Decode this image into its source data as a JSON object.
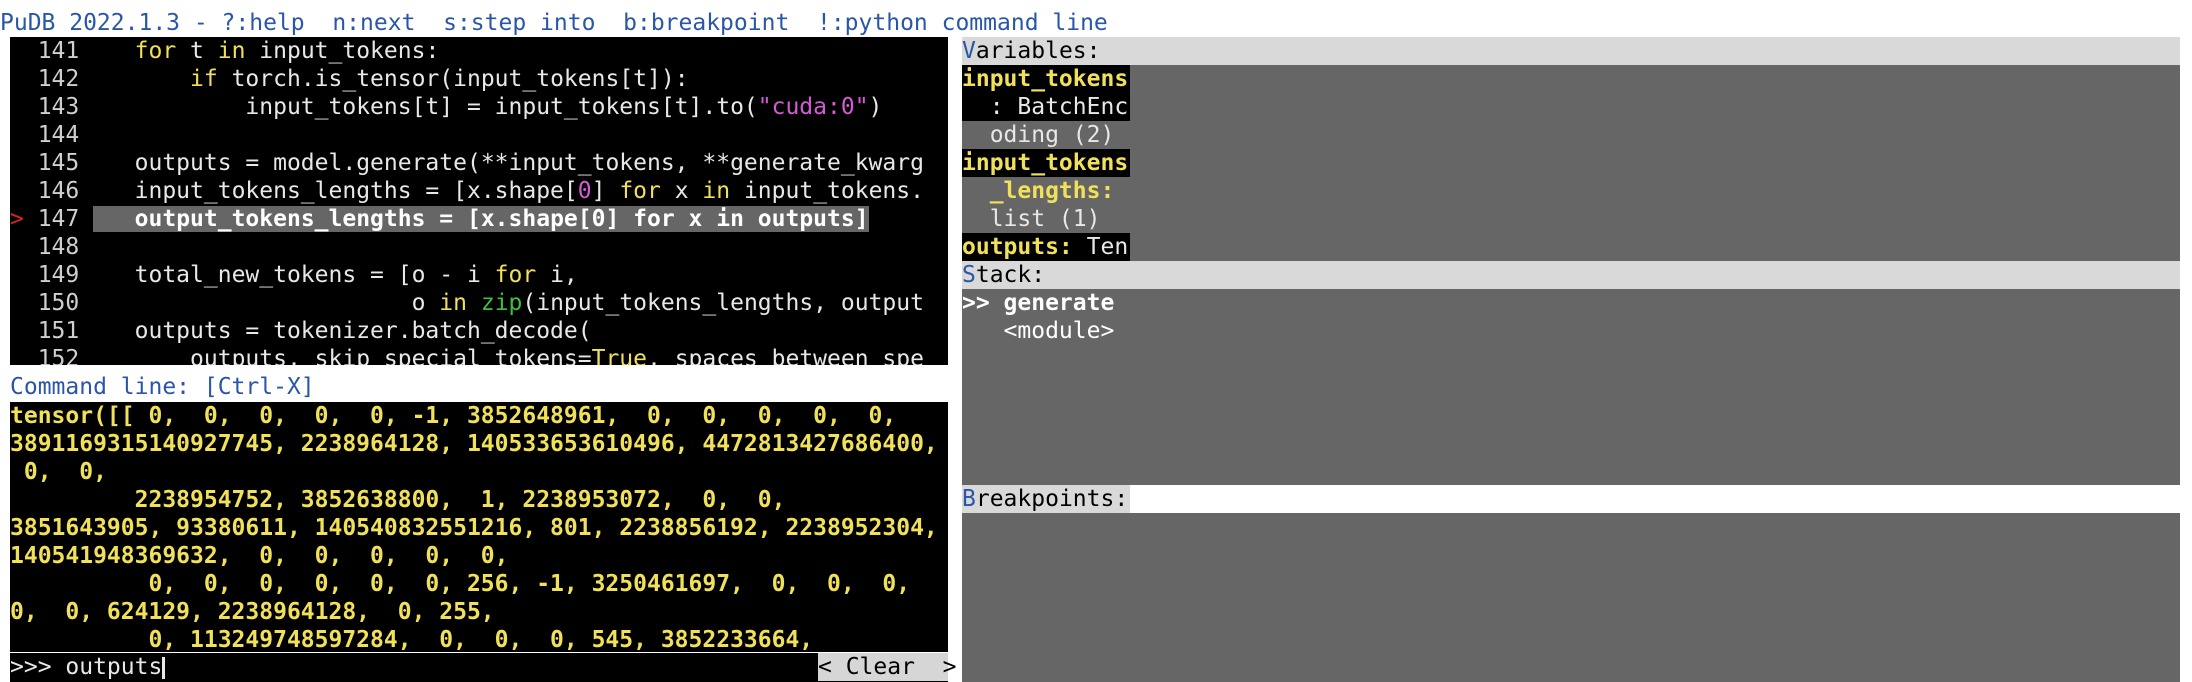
{
  "header": {
    "text": "PuDB 2022.1.3 - ?:help  n:next  s:step into  b:breakpoint  !:python command line"
  },
  "source": {
    "lines": [
      {
        "no": "141",
        "code": "    for t in input_tokens:"
      },
      {
        "no": "142",
        "code": "        if torch.is_tensor(input_tokens[t]):"
      },
      {
        "no": "143",
        "code": "            input_tokens[t] = input_tokens[t].to(\"cuda:0\")"
      },
      {
        "no": "144",
        "code": ""
      },
      {
        "no": "145",
        "code": "    outputs = model.generate(**input_tokens, **generate_kwarg"
      },
      {
        "no": "146",
        "code": "    input_tokens_lengths = [x.shape[0] for x in input_tokens."
      },
      {
        "no": "147",
        "code": "    output_tokens_lengths = [x.shape[0] for x in outputs]"
      },
      {
        "no": "148",
        "code": ""
      },
      {
        "no": "149",
        "code": "    total_new_tokens = [o - i for i,"
      },
      {
        "no": "150",
        "code": "                        o in zip(input_tokens_lengths, output"
      },
      {
        "no": "151",
        "code": "    outputs = tokenizer.batch_decode("
      },
      {
        "no": "152",
        "code": "        outputs, skip_special_tokens=True, spaces_between_spe"
      }
    ],
    "current_marker": ">"
  },
  "command_line": {
    "title": "Command line: [Ctrl-X]",
    "output": [
      "tensor([[ 0,  0,  0,  0,  0, -1, 3852648961,  0,  0,  0,  0,  0,",
      "3891169315140927745, 2238964128, 140533653610496, 4472813427686400,",
      " 0,  0,",
      "         2238954752, 3852638800,  1, 2238953072,  0,  0,",
      "3851643905, 93380611, 140540832551216, 801, 2238856192, 2238952304,",
      "140541948369632,  0,  0,  0,  0,  0,",
      "          0,  0,  0,  0,  0,  0, 256, -1, 3250461697,  0,  0,  0,",
      "0,  0, 624129, 2238964128,  0, 255,",
      "          0, 113249748597284,  0,  0,  0, 545, 3852233664,"
    ],
    "prompt": ">>> ",
    "input_value": "outputs",
    "clear_label": "< Clear  >"
  },
  "variables": {
    "title_first": "V",
    "title_rest": "ariables:",
    "lines": [
      {
        "text": "input_tokens",
        "style": "name"
      },
      {
        "text": "  : BatchEnc",
        "style": "light"
      },
      {
        "text": "  oding (2)",
        "style": "light"
      },
      {
        "text": "input_tokens",
        "style": "name"
      },
      {
        "text": "  _lengths:",
        "style": "name"
      },
      {
        "text": "  list (1)",
        "style": "light"
      },
      {
        "name": "outputs:",
        "value": " Ten",
        "style": "mixed"
      }
    ]
  },
  "stack": {
    "title_first": "S",
    "title_rest": "tack:",
    "frames": [
      {
        "text": ">> generate",
        "current": true
      },
      {
        "text": "   <module>",
        "current": false
      }
    ]
  },
  "breakpoints": {
    "title_first": "B",
    "title_rest": "reakpoints:"
  }
}
